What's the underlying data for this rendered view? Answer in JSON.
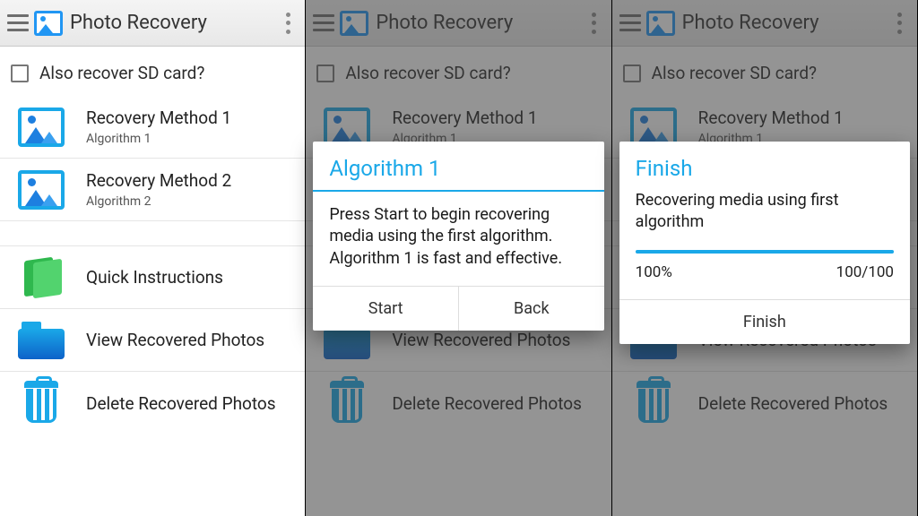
{
  "app": {
    "title": "Photo Recovery"
  },
  "sd_checkbox": {
    "label": "Also recover SD card?"
  },
  "methods": [
    {
      "title": "Recovery Method 1",
      "sub": "Algorithm 1"
    },
    {
      "title": "Recovery Method 2",
      "sub": "Algorithm 2"
    }
  ],
  "actions": {
    "instructions": "Quick Instructions",
    "view": "View Recovered Photos",
    "delete": "Delete Recovered Photos"
  },
  "dialog1": {
    "title": "Algorithm 1",
    "body": "Press Start to begin recovering media using the first algorithm. Algorithm 1 is fast and effective.",
    "start": "Start",
    "back": "Back"
  },
  "dialog2": {
    "title": "Finish",
    "body": "Recovering media using first algorithm",
    "percent": "100%",
    "count": "100/100",
    "finish": "Finish"
  }
}
